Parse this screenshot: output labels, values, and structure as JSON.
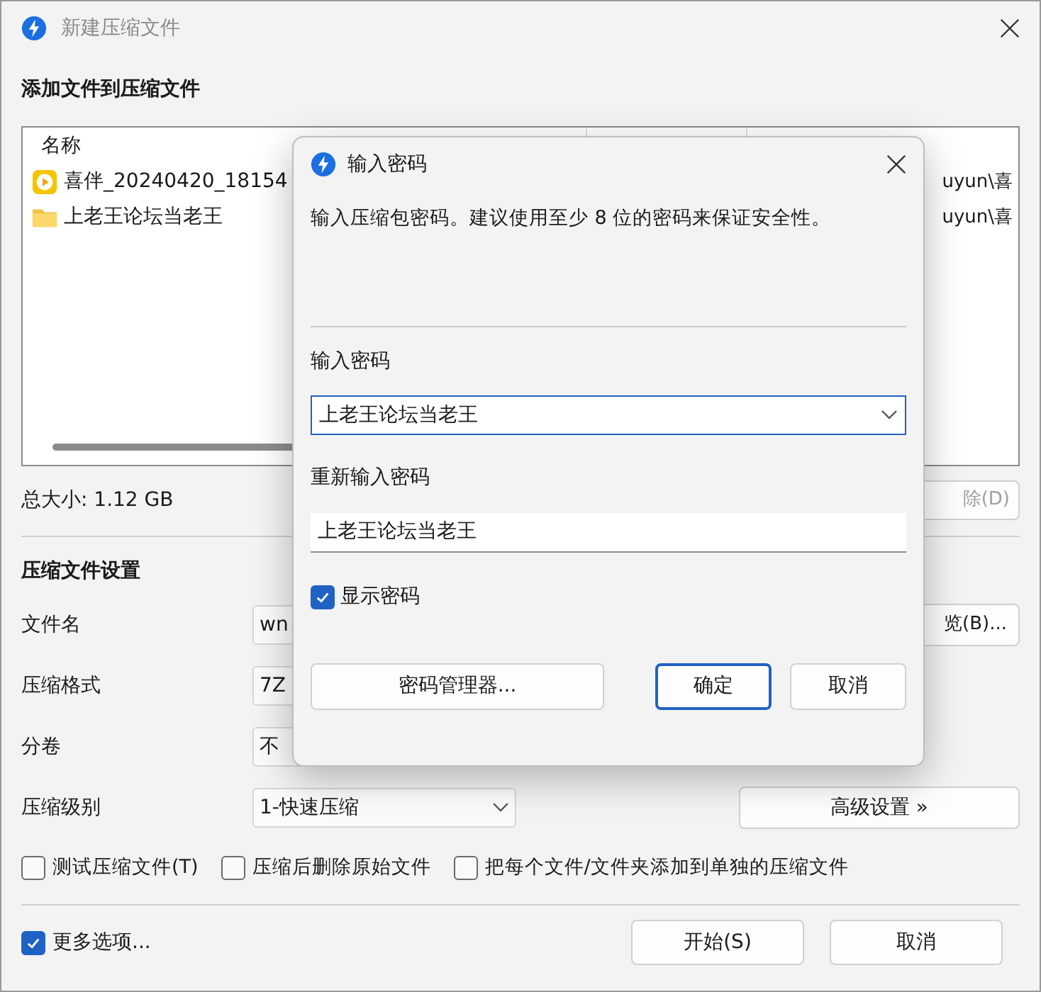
{
  "window": {
    "title": "新建压缩文件",
    "active": false
  },
  "files_section": {
    "heading": "添加文件到压缩文件",
    "columns": [
      "名称"
    ],
    "rows": [
      {
        "kind": "video",
        "name": "喜伴_20240420_18154",
        "path": "uyun\\喜"
      },
      {
        "kind": "folder",
        "name": "上老王论坛当老王",
        "path": "uyun\\喜"
      }
    ],
    "total_size": "总大小: 1.12 GB",
    "delete_button": {
      "label": "除(D)",
      "disabled": true
    }
  },
  "settings": {
    "heading": "压缩文件设置",
    "rows": [
      {
        "label": "文件名",
        "value": "wn",
        "kind": "text"
      },
      {
        "label": "压缩格式",
        "value": "7Z",
        "kind": "dropdown"
      },
      {
        "label": "分卷",
        "value": "不",
        "kind": "dropdown"
      },
      {
        "label": "压缩级别",
        "value": "1-快速压缩",
        "kind": "dropdown"
      }
    ],
    "browse_button": "览(B)...",
    "advanced_button": "高级设置 »",
    "options": [
      {
        "label": "测试压缩文件(T)",
        "checked": false
      },
      {
        "label": "压缩后删除原始文件",
        "checked": false
      },
      {
        "label": "把每个文件/文件夹添加到单独的压缩文件",
        "checked": false
      }
    ]
  },
  "footer": {
    "more_options": {
      "label": "更多选项...",
      "checked": true
    },
    "buttons": [
      {
        "label": "开始(S)",
        "default": false
      },
      {
        "label": "取消",
        "default": false
      }
    ]
  },
  "password_dialog": {
    "title": "输入密码",
    "description": "输入压缩包密码。建议使用至少 8 位的密码来保证安全性。",
    "password_label": "输入密码",
    "password_value": "上老王论坛当老王",
    "confirm_label": "重新输入密码",
    "confirm_value": "上老王论坛当老王",
    "show_password": {
      "label": "显示密码",
      "checked": true
    },
    "manager_button": "密码管理器...",
    "buttons": [
      {
        "label": "确定",
        "default": true
      },
      {
        "label": "取消",
        "default": false
      }
    ]
  }
}
